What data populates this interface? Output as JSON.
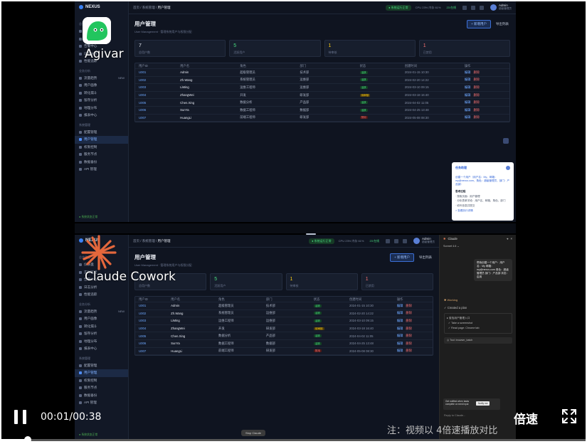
{
  "player": {
    "time": "00:01/00:38",
    "speed_label": "倍速",
    "note": "注：视频以 4倍速播放对比",
    "progress_fraction": 0.045
  },
  "labels": {
    "top": "Agivar",
    "bottom": "Claude Cowork"
  },
  "app": {
    "brand": "NEXUS",
    "breadcrumb_root": "首页",
    "breadcrumb_mid": "系统管理",
    "breadcrumb_current": "用户管理",
    "status_pill": "● 系统运行正常",
    "top_stat": "CPU 23%  内存 61%",
    "top_count": "23 在线",
    "user_name": "Admin",
    "user_role": "超级管理员",
    "page_title": "用户管理",
    "page_sub": "User Management · 管理系统用户与权限分配",
    "add_button": "+ 新增用户",
    "export_button": "导出列表",
    "stop_button": "Stop Claude",
    "sidebar": {
      "section_overview": "总览监控",
      "section_analysis": "业务分析",
      "section_system": "系统管理",
      "items_overview": [
        "仪表盘",
        "实时监控",
        "告警中心",
        "日志分析",
        "性能追踪"
      ],
      "items_analysis": [
        {
          "label": "流量趋势",
          "badge": "NEW"
        },
        {
          "label": "用户画像",
          "badge": ""
        },
        {
          "label": "转化漏斗",
          "badge": ""
        },
        {
          "label": "留存分析",
          "badge": ""
        },
        {
          "label": "地理分布",
          "badge": ""
        },
        {
          "label": "报表中心",
          "badge": ""
        }
      ],
      "items_system": [
        "配置管理",
        "用户管理",
        "权限控制",
        "服务节点",
        "数据备份",
        "API 管理"
      ],
      "footer": "● 系统状态正常"
    },
    "cards": [
      {
        "num": "7",
        "label": "总用户数",
        "color": "#e5e9f2"
      },
      {
        "num": "5",
        "label": "活跃用户",
        "color": "#4ade80"
      },
      {
        "num": "1",
        "label": "待审核",
        "color": "#facc15"
      },
      {
        "num": "1",
        "label": "已禁用",
        "color": "#f87171"
      }
    ],
    "table": {
      "headers": [
        "用户ID",
        "用户名",
        "角色",
        "部门",
        "状态",
        "创建时间",
        "操作"
      ],
      "rows": [
        {
          "id": "U001",
          "user": "Admin",
          "role": "超级管理员",
          "dept": "技术部",
          "status": "活跃",
          "kind": "active",
          "time": "2024-01-15 10:30"
        },
        {
          "id": "U002",
          "user": "Zh.Wang",
          "role": "系统管理员",
          "dept": "运维部",
          "status": "活跃",
          "kind": "active",
          "time": "2024-02-20 14:22"
        },
        {
          "id": "U003",
          "user": "LiMing",
          "role": "运维工程师",
          "dept": "运维部",
          "status": "活跃",
          "kind": "active",
          "time": "2024-03-10 09:15"
        },
        {
          "id": "U004",
          "user": "ZhangWei",
          "role": "开发",
          "dept": "研发部",
          "status": "待审核",
          "kind": "pending",
          "time": "2024-03-18 16:40"
        },
        {
          "id": "U005",
          "user": "Chen.Xing",
          "role": "数据分析",
          "dept": "产品部",
          "status": "活跃",
          "kind": "active",
          "time": "2024-04-02 11:05"
        },
        {
          "id": "U006",
          "user": "SunYa",
          "role": "数据工程师",
          "dept": "数据部",
          "status": "活跃",
          "kind": "active",
          "time": "2024-04-25 13:48"
        },
        {
          "id": "U007",
          "user": "HuangLi",
          "role": "前端工程师",
          "dept": "研发部",
          "status": "禁用",
          "kind": "disabled",
          "time": "2024-05-08 08:30"
        }
      ],
      "edit_label": "编辑",
      "delete_label": "删除"
    }
  },
  "agivar_dialog": {
    "title": "任务助理",
    "question": "创建一个用户（用户名：My，邮箱：my@nexus.com，角色：超级管理员，部门：产品部）",
    "section": "思考过程",
    "lines": [
      "· 搜索页面：用户管理",
      "· 分析表单字段：用户名、邮箱、角色、部门",
      "· 填写信息并提交"
    ],
    "link": "> 查看执行详情"
  },
  "claude_panel": {
    "title": "Claude",
    "model": "Sonnet 4.6",
    "request": "帮我创建一个用户：用户名：My 邮箱：my@nexus.com 角色：超级管理员 部门：产品部 状态：启用",
    "working": "Working",
    "created": "Created a plan",
    "plan_items": [
      "查找用户管理入口",
      "Take a screenshot",
      "Read page: Chrome tab"
    ],
    "tool": "Tool: browser_batch",
    "toast_text": "Get notified when tasks complete or need input",
    "toast_button": "Notify me",
    "reply": "Reply to Claude..."
  }
}
